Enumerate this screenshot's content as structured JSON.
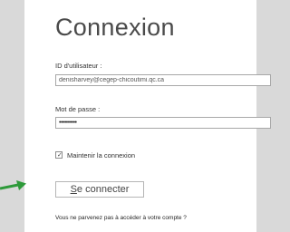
{
  "page": {
    "title": "Connexion"
  },
  "form": {
    "userid_label": "ID d'utilisateur :",
    "userid_value": "denisharvey@cegep-chicoutimi.qc.ca",
    "password_label": "Mot de passe :",
    "password_value": "••••••••••",
    "remember_label": "Maintenir la connexion",
    "remember_checked": true,
    "checkmark": "✓",
    "signin_accel": "S",
    "signin_rest": "e connecter",
    "help_link": "Vous ne parvenez pas à accéder à votre compte ?"
  },
  "colors": {
    "arrow": "#2e9a3a",
    "background": "#d9d9d9"
  },
  "icons": {
    "arrow": "arrow-right-icon"
  }
}
